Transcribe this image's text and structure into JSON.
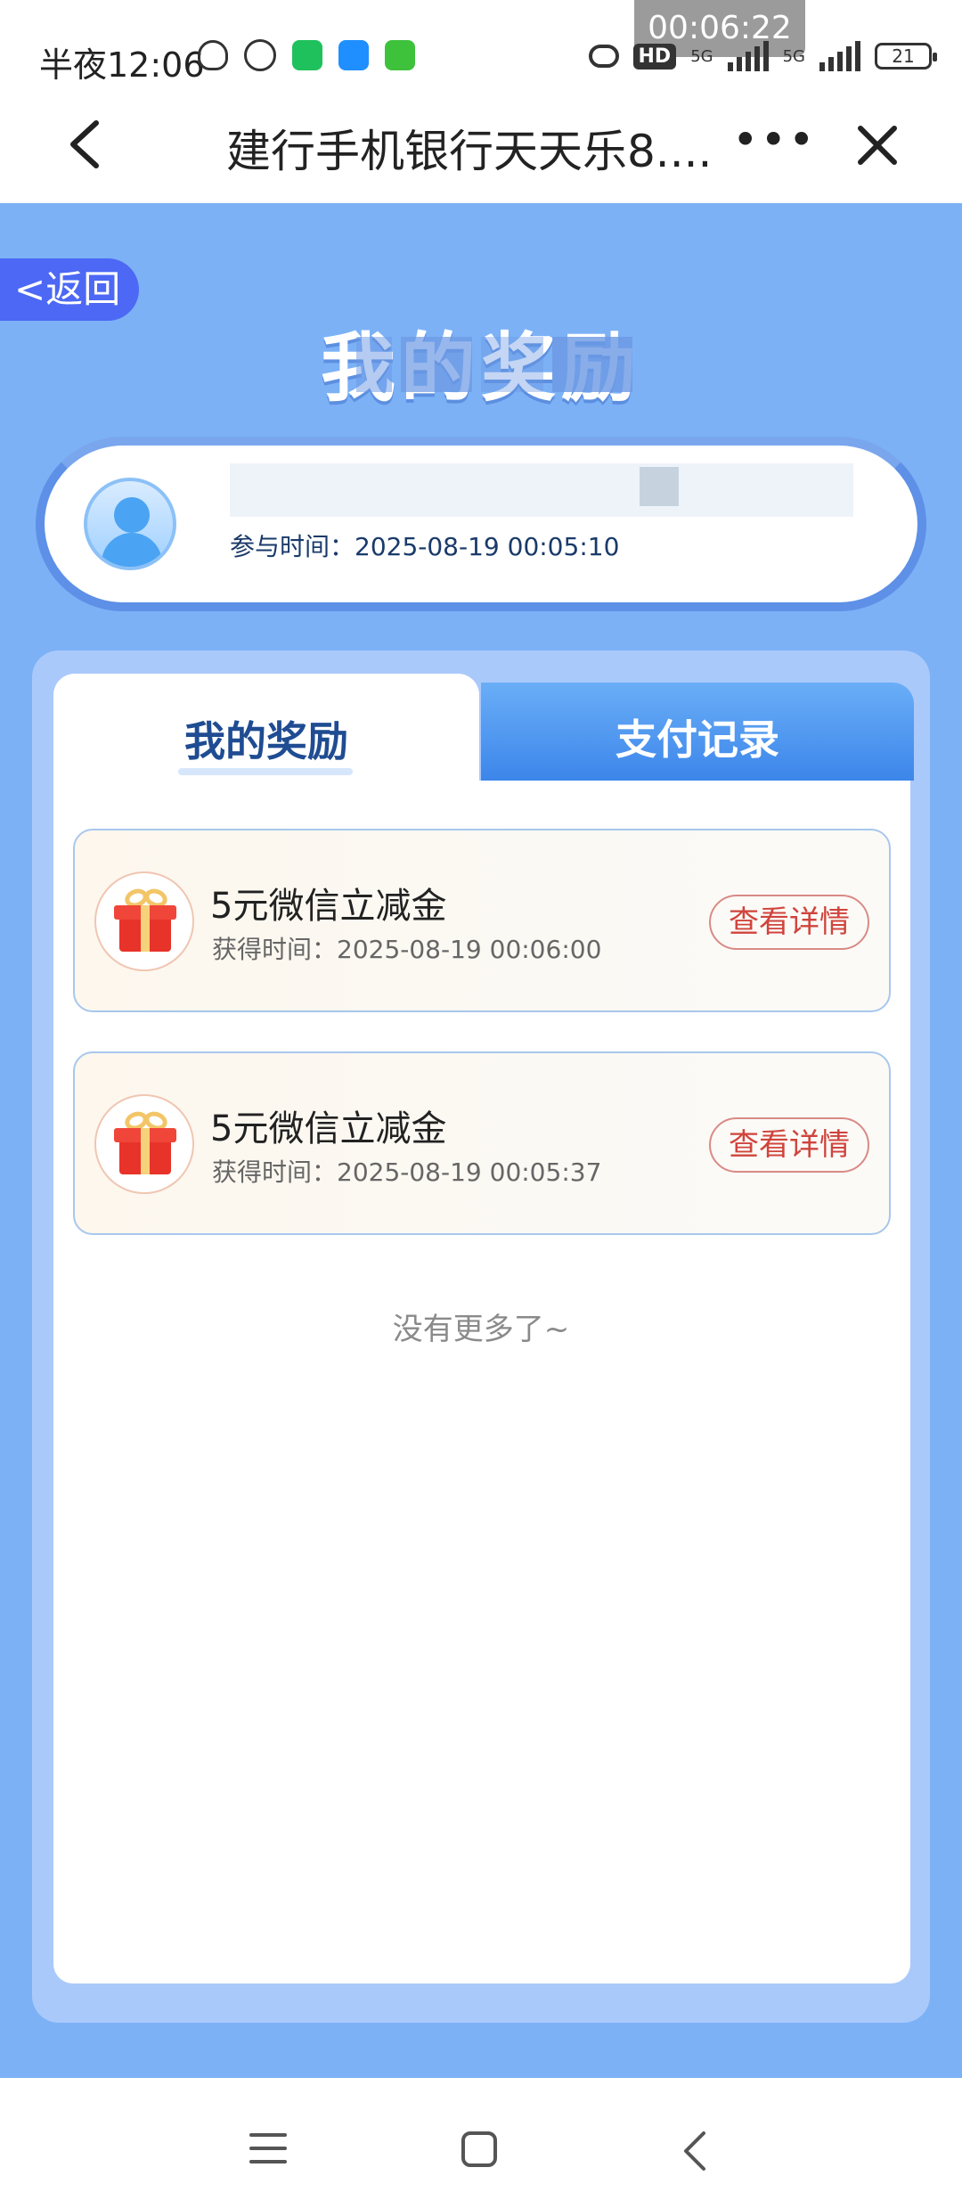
{
  "status_bar": {
    "time": "半夜12:06",
    "recording_timer": "00:06:22",
    "network_5g_a": "5G",
    "network_5g_b": "5G",
    "hd_label": "HD",
    "battery": "21"
  },
  "header": {
    "title": "建行手机银行天天乐8....",
    "more_label": "•••"
  },
  "page": {
    "back_label": "<返回",
    "heading": "我的奖励"
  },
  "user": {
    "join_time": "参与时间：2025-08-19 00:05:10"
  },
  "tabs": [
    {
      "label": "我的奖励",
      "active": true
    },
    {
      "label": "支付记录",
      "active": false
    }
  ],
  "rewards": [
    {
      "title": "5元微信立减金",
      "time": "获得时间：2025-08-19 00:06:00",
      "button": "查看详情"
    },
    {
      "title": "5元微信立减金",
      "time": "获得时间：2025-08-19 00:05:37",
      "button": "查看详情"
    }
  ],
  "list_end_text": "没有更多了~",
  "colors": {
    "page_background": "#7cb1f6",
    "panel": "#aac9fb",
    "active_tab_text": "#1f4c92",
    "inactive_tab": "#4f98f0",
    "detail_button": "#d0443d"
  }
}
